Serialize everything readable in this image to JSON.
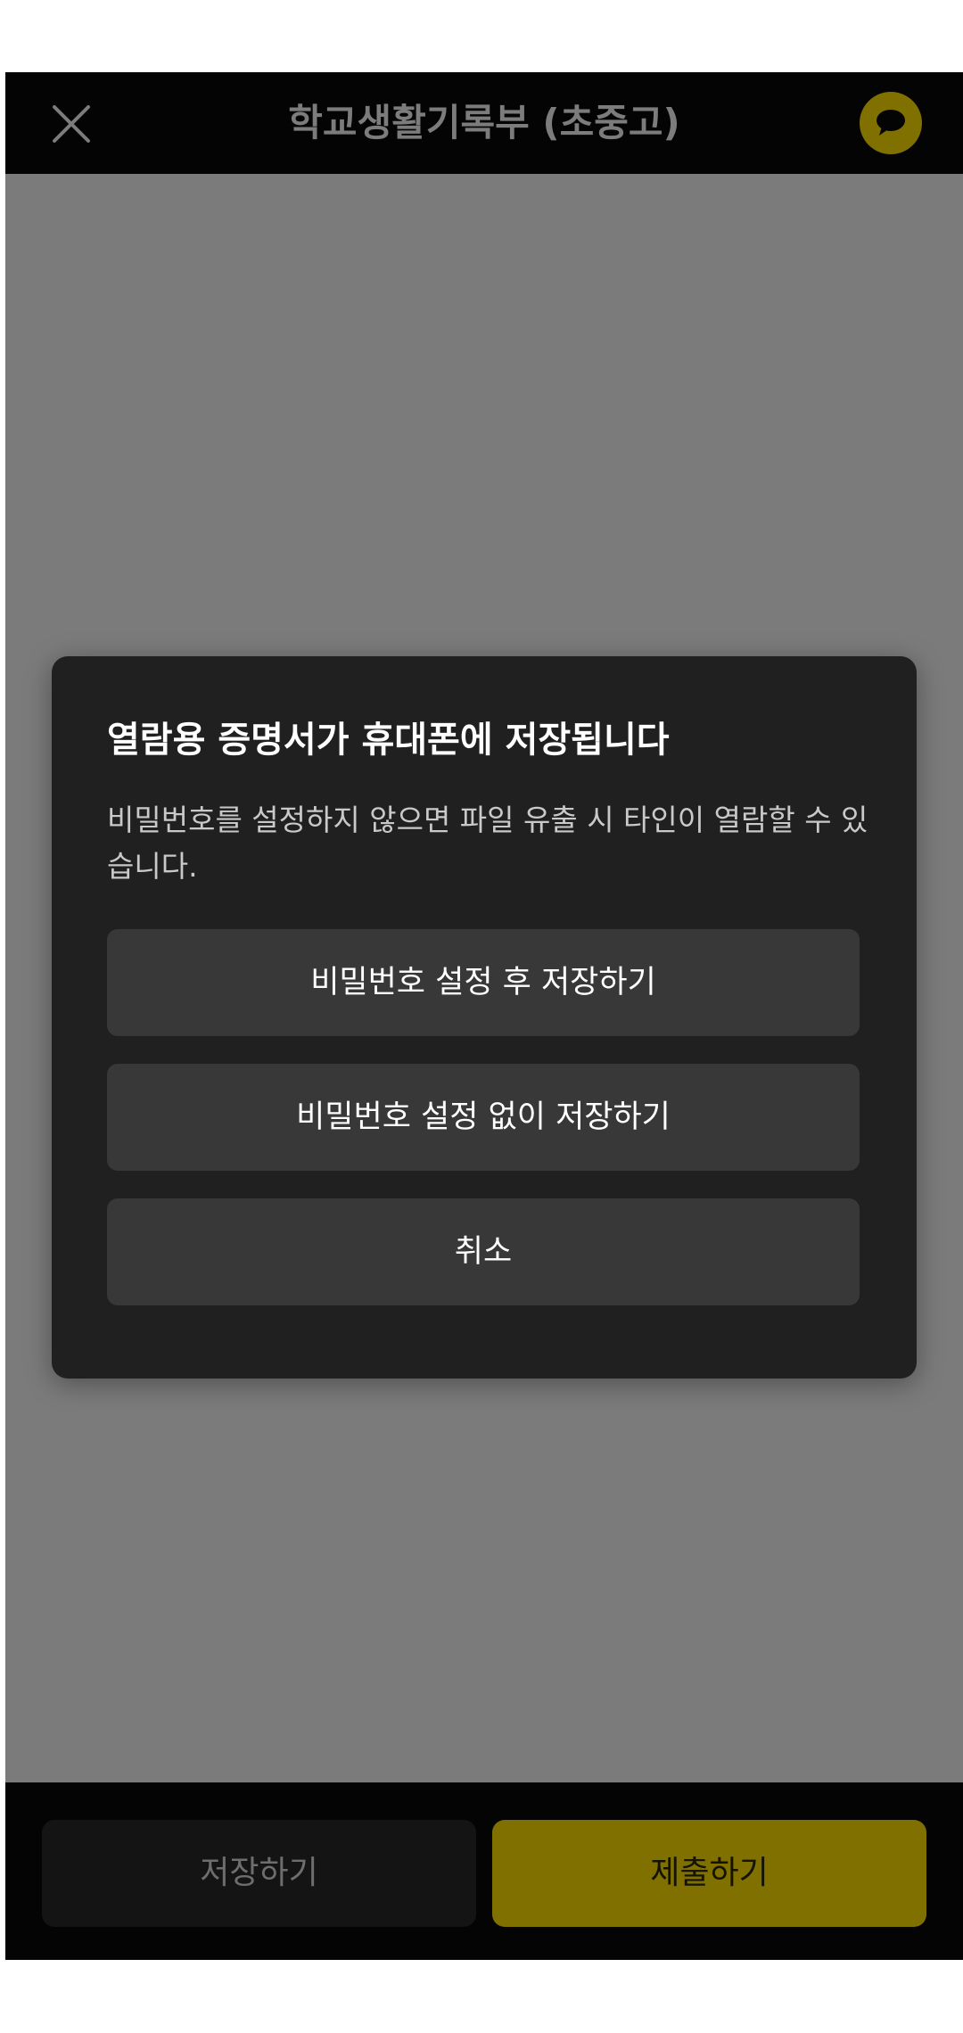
{
  "header": {
    "title": "학교생활기록부 (초중고)",
    "close_icon": "close-icon",
    "chat_icon": "chat-bubble-icon"
  },
  "dialog": {
    "title": "열람용 증명서가 휴대폰에 저장됩니다",
    "message": "비밀번호를 설정하지 않으면 파일 유출 시 타인이 열람할 수 있습니다.",
    "buttons": [
      {
        "label": "비밀번호 설정 후 저장하기"
      },
      {
        "label": "비밀번호 설정 없이 저장하기"
      },
      {
        "label": "취소"
      }
    ]
  },
  "bottom": {
    "save_label": "저장하기",
    "submit_label": "제출하기"
  },
  "colors": {
    "accent": "#807000",
    "overlay": "#7b7b7b",
    "dialog_bg": "#202020",
    "dialog_button_bg": "#383838"
  }
}
